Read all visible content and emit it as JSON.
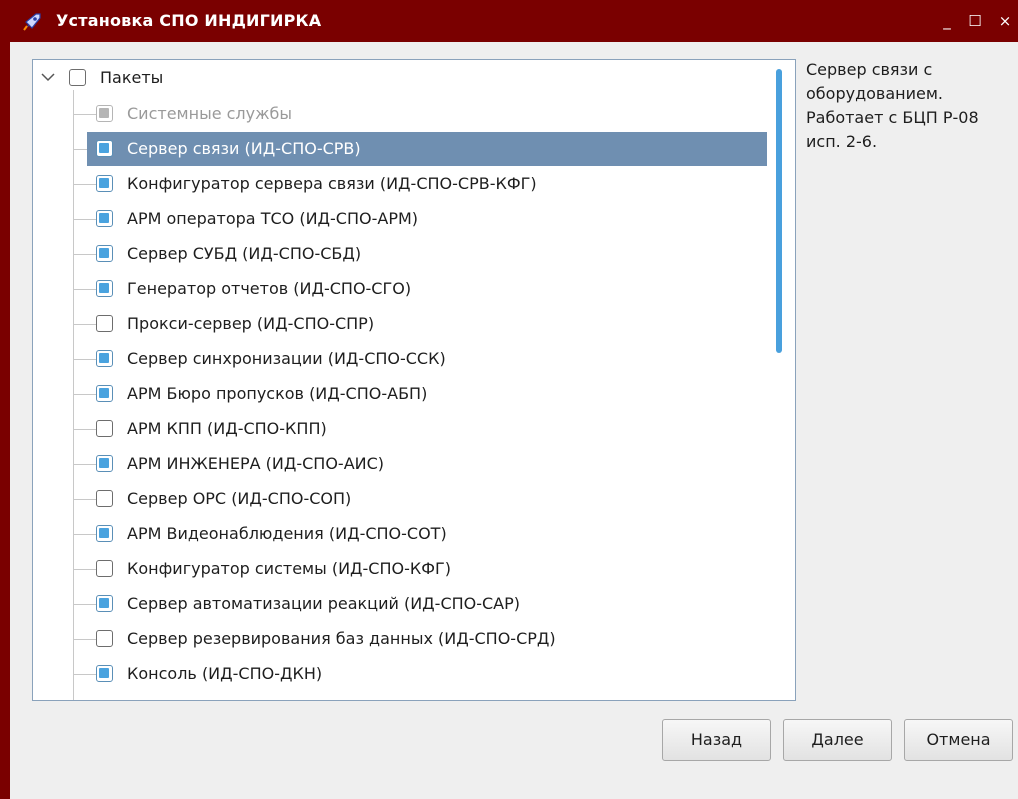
{
  "window": {
    "title": "Установка СПО ИНДИГИРКА",
    "controls": {
      "minimize": "_",
      "maximize": "☐",
      "close": "×"
    }
  },
  "tree": {
    "root": {
      "label": "Пакеты",
      "checked": false,
      "expanded": true
    },
    "items": [
      {
        "label": "Системные службы",
        "state": "disabled"
      },
      {
        "label": "Сервер связи (ИД-СПО-СРВ)",
        "state": "checked",
        "selected": true
      },
      {
        "label": "Конфигуратор сервера связи (ИД-СПО-СРВ-КФГ)",
        "state": "checked"
      },
      {
        "label": "АРМ оператора ТСО (ИД-СПО-АРМ)",
        "state": "checked"
      },
      {
        "label": "Сервер СУБД (ИД-СПО-СБД)",
        "state": "checked"
      },
      {
        "label": "Генератор отчетов (ИД-СПО-СГО)",
        "state": "checked"
      },
      {
        "label": "Прокси-сервер (ИД-СПО-СПР)",
        "state": "unchecked"
      },
      {
        "label": "Сервер синхронизации (ИД-СПО-ССК)",
        "state": "checked"
      },
      {
        "label": "АРМ Бюро пропусков (ИД-СПО-АБП)",
        "state": "checked"
      },
      {
        "label": "АРМ КПП (ИД-СПО-КПП)",
        "state": "unchecked"
      },
      {
        "label": "АРМ ИНЖЕНЕРА (ИД-СПО-АИС)",
        "state": "checked"
      },
      {
        "label": "Сервер ОРС (ИД-СПО-СОП)",
        "state": "unchecked"
      },
      {
        "label": "АРМ Видеонаблюдения (ИД-СПО-СОТ)",
        "state": "checked"
      },
      {
        "label": "Конфигуратор системы (ИД-СПО-КФГ)",
        "state": "unchecked"
      },
      {
        "label": "Сервер автоматизации реакций (ИД-СПО-САР)",
        "state": "checked"
      },
      {
        "label": "Сервер резервирования баз данных (ИД-СПО-СРД)",
        "state": "unchecked"
      },
      {
        "label": "Консоль (ИД-СПО-ДКН)",
        "state": "checked"
      },
      {
        "label": "",
        "state": "checked"
      }
    ]
  },
  "description": {
    "lines": [
      "Сервер связи с",
      "оборудованием.",
      "Работает с БЦП Р-08",
      "исп. 2-6."
    ]
  },
  "buttons": {
    "back": "Назад",
    "next": "Далее",
    "cancel": "Отмена"
  },
  "colors": {
    "titlebar": "#7a0000",
    "selection": "#6f8fb1",
    "check_fill": "#4aa3df"
  }
}
